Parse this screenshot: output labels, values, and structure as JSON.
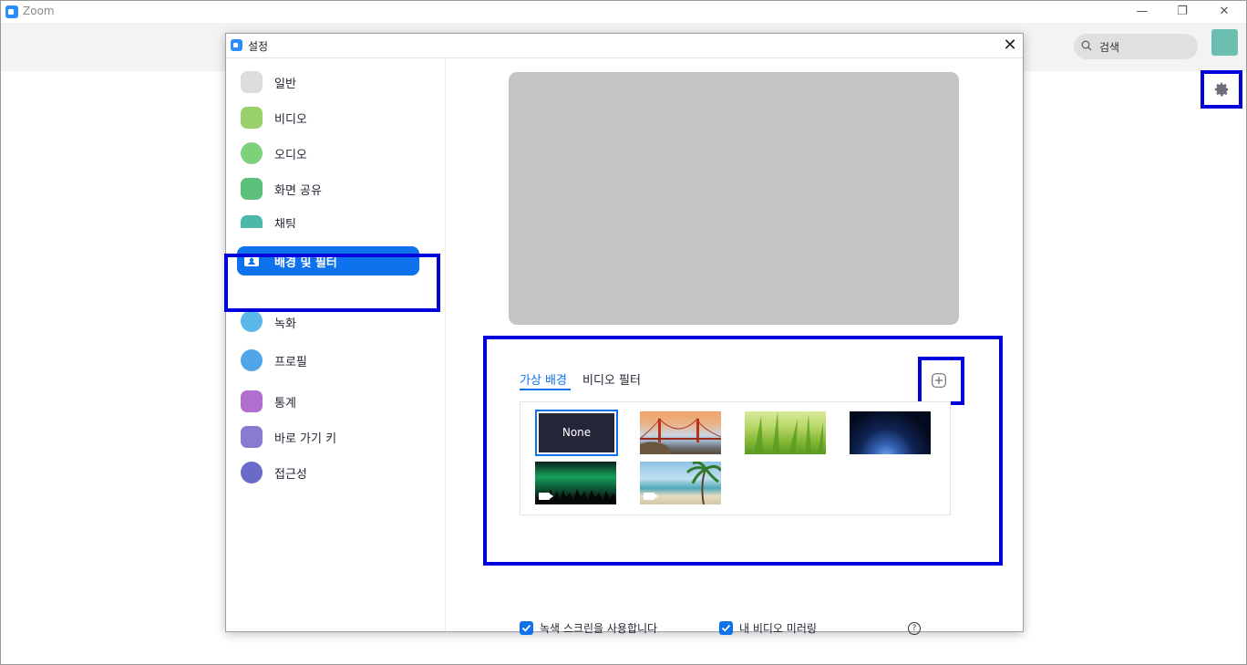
{
  "window": {
    "title": "Zoom",
    "controls": {
      "minimize": "—",
      "maximize": "❐",
      "close": "✕"
    }
  },
  "header": {
    "search_placeholder": "검색",
    "avatar_color": "#6cbfb0"
  },
  "dialog": {
    "title": "설정",
    "close": "✕"
  },
  "sidebar": {
    "items": [
      {
        "label": "일반",
        "icon": "gear-icon",
        "color": "#dcdcdc"
      },
      {
        "label": "비디오",
        "icon": "video-camera-icon",
        "color": "#9bd16b"
      },
      {
        "label": "오디오",
        "icon": "headphones-icon",
        "color": "#7dd17c"
      },
      {
        "label": "화면 공유",
        "icon": "share-screen-icon",
        "color": "#5cc07a"
      },
      {
        "label": "채팅",
        "icon": "chat-icon",
        "color": "#4cb9a8"
      },
      {
        "label": "배경 및 필터",
        "icon": "background-icon",
        "color": "#0e72ed",
        "active": true
      },
      {
        "label": "녹화",
        "icon": "record-icon",
        "color": "#5ab8e8"
      },
      {
        "label": "프로필",
        "icon": "profile-icon",
        "color": "#4ea5ea"
      },
      {
        "label": "통계",
        "icon": "stats-icon",
        "color": "#b36fd0"
      },
      {
        "label": "바로 가기 키",
        "icon": "keyboard-icon",
        "color": "#8a7ad0"
      },
      {
        "label": "접근성",
        "icon": "accessibility-icon",
        "color": "#6a6ac8"
      }
    ]
  },
  "background": {
    "tabs": [
      "가상 배경",
      "비디오 필터"
    ],
    "active_tab": "가상 배경",
    "thumbnails": [
      {
        "label": "None",
        "selected": true
      },
      {
        "label": "golden-gate-bridge"
      },
      {
        "label": "grass"
      },
      {
        "label": "earth-from-space"
      },
      {
        "label": "aurora",
        "video": true
      },
      {
        "label": "beach-palm",
        "video": true
      }
    ]
  },
  "options": {
    "green_screen": {
      "label": "녹색 스크린을 사용합니다",
      "checked": true
    },
    "mirror_video": {
      "label": "내 비디오 미러링",
      "checked": true
    }
  },
  "colors": {
    "accent": "#0e72ed",
    "highlight_box": "#0000dd"
  }
}
